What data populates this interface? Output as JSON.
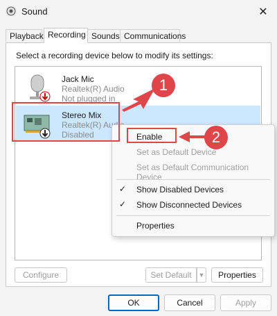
{
  "window": {
    "title": "Sound",
    "close_glyph": "✕"
  },
  "tabs": [
    {
      "label": "Playback"
    },
    {
      "label": "Recording"
    },
    {
      "label": "Sounds"
    },
    {
      "label": "Communications"
    }
  ],
  "instruction": "Select a recording device below to modify its settings:",
  "devices": [
    {
      "name": "Jack Mic",
      "driver": "Realtek(R) Audio",
      "status": "Not plugged in",
      "icon": "microphone-icon"
    },
    {
      "name": "Stereo Mix",
      "driver": "Realtek(R) Audio",
      "status": "Disabled",
      "icon": "sound-card-icon"
    }
  ],
  "context_menu": {
    "items": [
      {
        "label": "Enable",
        "enabled": true,
        "checked": false
      },
      {
        "label": "Set as Default Device",
        "enabled": false,
        "checked": false
      },
      {
        "label": "Set as Default Communication Device",
        "enabled": false,
        "checked": false
      },
      {
        "label": "Show Disabled Devices",
        "enabled": true,
        "checked": true
      },
      {
        "label": "Show Disconnected Devices",
        "enabled": true,
        "checked": true
      },
      {
        "label": "Properties",
        "enabled": true,
        "checked": false
      }
    ],
    "check_glyph": "✓"
  },
  "panel_buttons": {
    "configure": "Configure",
    "set_default": "Set Default",
    "properties": "Properties"
  },
  "dialog_buttons": {
    "ok": "OK",
    "cancel": "Cancel",
    "apply": "Apply"
  },
  "annotations": {
    "step1": "1",
    "step2": "2",
    "color": "#e0454a"
  }
}
